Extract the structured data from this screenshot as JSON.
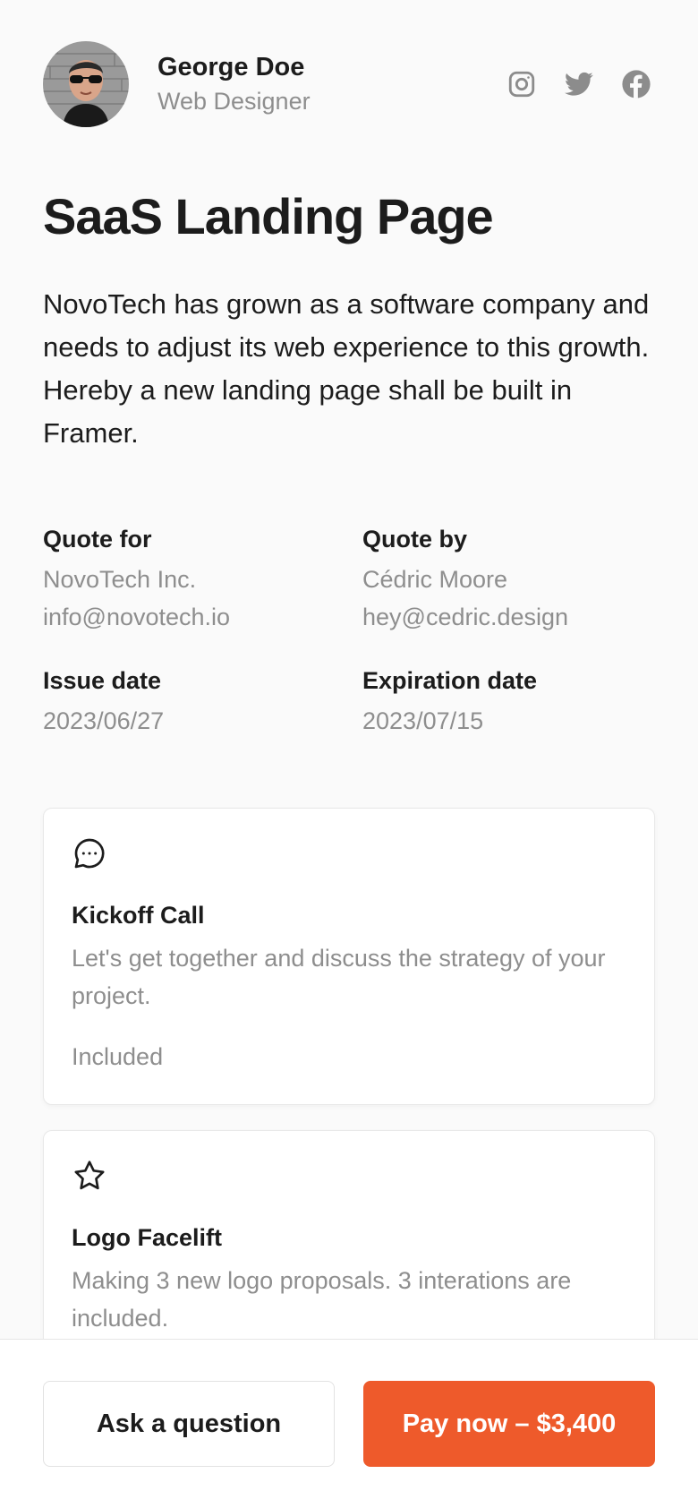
{
  "profile": {
    "name": "George Doe",
    "role": "Web Designer"
  },
  "socials": [
    "instagram-icon",
    "twitter-icon",
    "facebook-icon"
  ],
  "quote": {
    "title": "SaaS Landing Page",
    "intro": "NovoTech has grown as a software company and needs to adjust its web experience to this growth. Hereby a new landing page shall be built in Framer."
  },
  "meta": {
    "quote_for_label": "Quote for",
    "quote_for_company": "NovoTech Inc.",
    "quote_for_email": "info@novotech.io",
    "quote_by_label": "Quote by",
    "quote_by_name": "Cédric Moore",
    "quote_by_email": "hey@cedric.design",
    "issue_label": "Issue date",
    "issue_value": "2023/06/27",
    "expiration_label": "Expiration date",
    "expiration_value": "2023/07/15"
  },
  "services": [
    {
      "icon": "chat-bubble-icon",
      "title": "Kickoff Call",
      "description": "Let's get together and discuss the strategy of your project.",
      "price": "Included"
    },
    {
      "icon": "star-icon",
      "title": "Logo Facelift",
      "description": "Making 3 new logo proposals. 3 interations are included.",
      "price": ""
    }
  ],
  "actions": {
    "ask_label": "Ask a question",
    "pay_label": "Pay now – $3,400"
  },
  "colors": {
    "accent": "#ee5a2b",
    "muted_text": "#8e8e8e",
    "text": "#1c1c1c"
  }
}
